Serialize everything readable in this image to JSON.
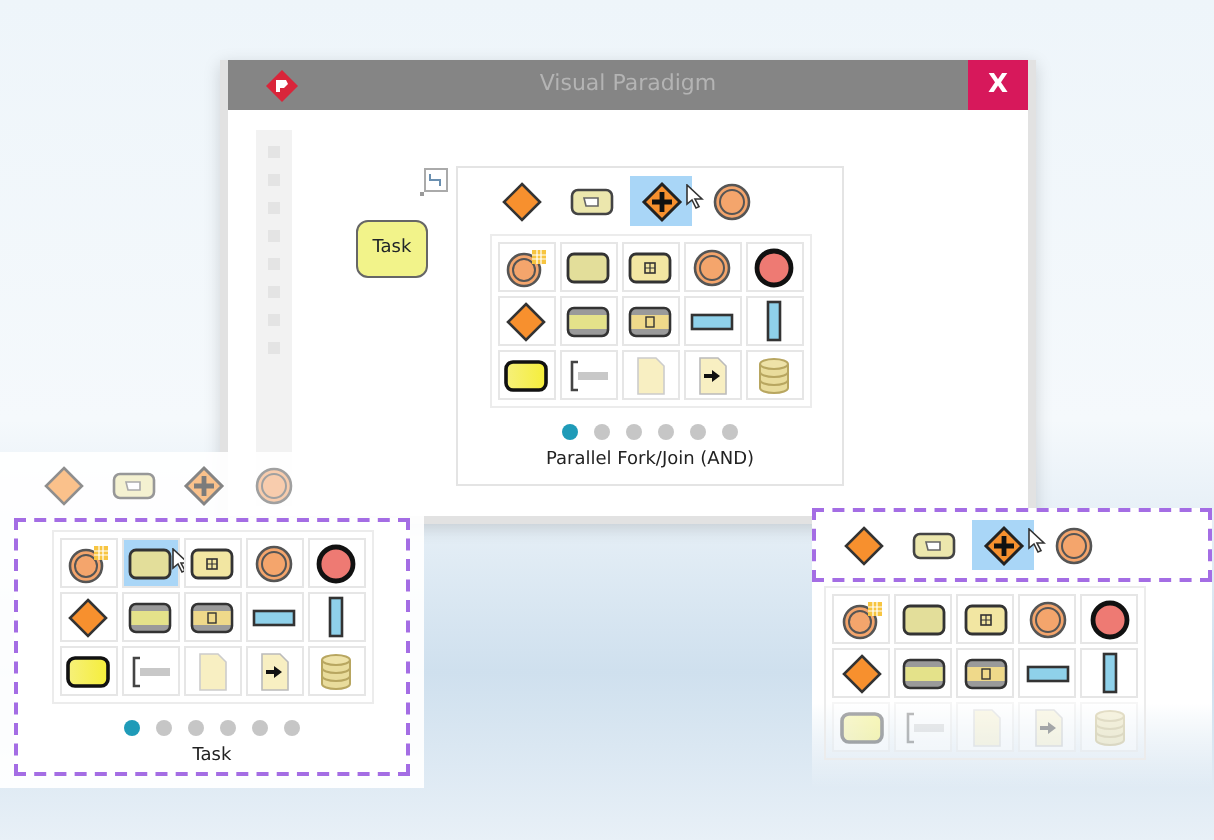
{
  "window": {
    "title": "Visual Paradigm",
    "close": "X"
  },
  "canvas": {
    "task_label": "Task"
  },
  "main_palette": {
    "recent": [
      {
        "kind": "gateway",
        "selected": false
      },
      {
        "kind": "manual-task",
        "selected": false
      },
      {
        "kind": "parallel-gateway",
        "selected": true
      },
      {
        "kind": "event",
        "selected": false
      }
    ],
    "grid": [
      {
        "kind": "timer-event",
        "selected": false
      },
      {
        "kind": "task",
        "selected": false
      },
      {
        "kind": "subprocess",
        "selected": false
      },
      {
        "kind": "event",
        "selected": false
      },
      {
        "kind": "end-event",
        "selected": false
      },
      {
        "kind": "gateway",
        "selected": false
      },
      {
        "kind": "pool",
        "selected": false
      },
      {
        "kind": "pool-subprocess",
        "selected": false
      },
      {
        "kind": "lane-h",
        "selected": false
      },
      {
        "kind": "lane-v",
        "selected": false
      },
      {
        "kind": "highlight-task",
        "selected": false
      },
      {
        "kind": "annotation",
        "selected": false
      },
      {
        "kind": "document",
        "selected": false
      },
      {
        "kind": "input-document",
        "selected": false
      },
      {
        "kind": "database",
        "selected": false
      }
    ],
    "pages": [
      {
        "selected": true
      },
      {
        "selected": false
      },
      {
        "selected": false
      },
      {
        "selected": false
      },
      {
        "selected": false
      },
      {
        "selected": false
      }
    ],
    "caption": "Parallel Fork/Join (AND)"
  },
  "left_callout": {
    "recent": [
      {
        "kind": "gateway",
        "selected": false
      },
      {
        "kind": "manual-task",
        "selected": false
      },
      {
        "kind": "parallel-gateway",
        "selected": false
      },
      {
        "kind": "event",
        "selected": false
      }
    ],
    "grid": [
      {
        "kind": "timer-event",
        "selected": false
      },
      {
        "kind": "task",
        "selected": true
      },
      {
        "kind": "subprocess",
        "selected": false
      },
      {
        "kind": "event",
        "selected": false
      },
      {
        "kind": "end-event",
        "selected": false
      },
      {
        "kind": "gateway",
        "selected": false
      },
      {
        "kind": "pool",
        "selected": false
      },
      {
        "kind": "pool-subprocess",
        "selected": false
      },
      {
        "kind": "lane-h",
        "selected": false
      },
      {
        "kind": "lane-v",
        "selected": false
      },
      {
        "kind": "highlight-task",
        "selected": false
      },
      {
        "kind": "annotation",
        "selected": false
      },
      {
        "kind": "document",
        "selected": false
      },
      {
        "kind": "input-document",
        "selected": false
      },
      {
        "kind": "database",
        "selected": false
      }
    ],
    "pages": [
      {
        "selected": true
      },
      {
        "selected": false
      },
      {
        "selected": false
      },
      {
        "selected": false
      },
      {
        "selected": false
      },
      {
        "selected": false
      }
    ],
    "caption": "Task"
  },
  "right_callout": {
    "recent": [
      {
        "kind": "gateway",
        "selected": false
      },
      {
        "kind": "manual-task",
        "selected": false
      },
      {
        "kind": "parallel-gateway",
        "selected": true
      },
      {
        "kind": "event",
        "selected": false
      }
    ],
    "grid": [
      {
        "kind": "timer-event",
        "selected": false
      },
      {
        "kind": "task",
        "selected": false
      },
      {
        "kind": "subprocess",
        "selected": false
      },
      {
        "kind": "event",
        "selected": false
      },
      {
        "kind": "end-event",
        "selected": false
      },
      {
        "kind": "gateway",
        "selected": false
      },
      {
        "kind": "pool",
        "selected": false
      },
      {
        "kind": "pool-subprocess",
        "selected": false
      },
      {
        "kind": "lane-h",
        "selected": false
      },
      {
        "kind": "lane-v",
        "selected": false
      },
      {
        "kind": "highlight-task",
        "selected": false
      },
      {
        "kind": "annotation",
        "selected": false
      },
      {
        "kind": "document",
        "selected": false
      },
      {
        "kind": "input-document",
        "selected": false
      },
      {
        "kind": "database",
        "selected": false
      }
    ]
  }
}
